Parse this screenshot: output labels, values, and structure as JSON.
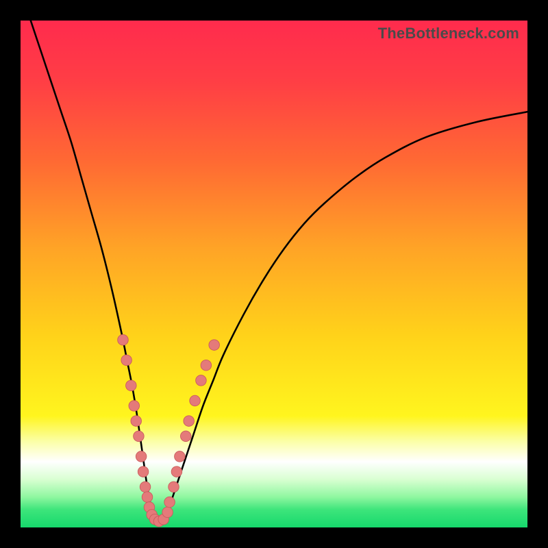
{
  "watermark": "TheBottleneck.com",
  "colors": {
    "frame": "#000000",
    "curve": "#000000",
    "dot_fill": "#e47a7a",
    "dot_stroke": "#c95c5c",
    "gradient_stops": [
      {
        "pos": 0.0,
        "color": "#ff2b4d"
      },
      {
        "pos": 0.12,
        "color": "#ff3e45"
      },
      {
        "pos": 0.28,
        "color": "#ff6a33"
      },
      {
        "pos": 0.45,
        "color": "#ffa426"
      },
      {
        "pos": 0.62,
        "color": "#ffd21a"
      },
      {
        "pos": 0.78,
        "color": "#fff51e"
      },
      {
        "pos": 0.83,
        "color": "#fbffa6"
      },
      {
        "pos": 0.87,
        "color": "#ffffff"
      },
      {
        "pos": 0.905,
        "color": "#d9ffd2"
      },
      {
        "pos": 0.94,
        "color": "#8ff7a0"
      },
      {
        "pos": 0.965,
        "color": "#3de57b"
      },
      {
        "pos": 1.0,
        "color": "#16d86c"
      }
    ]
  },
  "chart_data": {
    "type": "line",
    "title": "",
    "xlabel": "",
    "ylabel": "",
    "xlim": [
      0,
      100
    ],
    "ylim": [
      0,
      100
    ],
    "series": [
      {
        "name": "bottleneck-curve",
        "x": [
          2,
          4,
          6,
          8,
          10,
          12,
          14,
          16,
          18,
          20,
          21,
          22,
          23,
          24,
          25,
          26,
          27,
          28,
          29,
          30,
          32,
          34,
          36,
          38,
          40,
          44,
          48,
          52,
          56,
          60,
          66,
          72,
          80,
          90,
          100
        ],
        "y": [
          100,
          94,
          88,
          82,
          76,
          69,
          62,
          55,
          47,
          38,
          33,
          28,
          22,
          15,
          8,
          3,
          1,
          1,
          3,
          6,
          12,
          18,
          24,
          29,
          34,
          42,
          49,
          55,
          60,
          64,
          69,
          73,
          77,
          80,
          82
        ]
      }
    ],
    "highlight_points": {
      "name": "marker-dots",
      "points": [
        {
          "x": 20.2,
          "y": 37
        },
        {
          "x": 20.9,
          "y": 33
        },
        {
          "x": 21.8,
          "y": 28
        },
        {
          "x": 22.4,
          "y": 24
        },
        {
          "x": 22.8,
          "y": 21
        },
        {
          "x": 23.3,
          "y": 18
        },
        {
          "x": 23.8,
          "y": 14
        },
        {
          "x": 24.2,
          "y": 11
        },
        {
          "x": 24.6,
          "y": 8
        },
        {
          "x": 25.0,
          "y": 6
        },
        {
          "x": 25.4,
          "y": 4
        },
        {
          "x": 25.9,
          "y": 2.5
        },
        {
          "x": 26.5,
          "y": 1.6
        },
        {
          "x": 27.3,
          "y": 1.2
        },
        {
          "x": 28.2,
          "y": 1.6
        },
        {
          "x": 29.0,
          "y": 3
        },
        {
          "x": 29.4,
          "y": 5
        },
        {
          "x": 30.2,
          "y": 8
        },
        {
          "x": 30.8,
          "y": 11
        },
        {
          "x": 31.4,
          "y": 14
        },
        {
          "x": 32.6,
          "y": 18
        },
        {
          "x": 33.2,
          "y": 21
        },
        {
          "x": 34.4,
          "y": 25
        },
        {
          "x": 35.6,
          "y": 29
        },
        {
          "x": 36.6,
          "y": 32
        },
        {
          "x": 38.2,
          "y": 36
        }
      ]
    }
  }
}
